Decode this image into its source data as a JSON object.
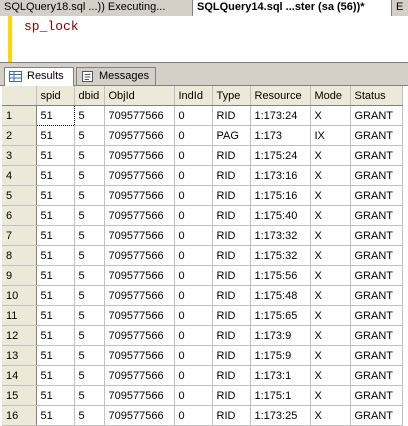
{
  "doc_tabs": [
    {
      "label": "SQLQuery18.sql ...)) Executing..."
    },
    {
      "label": "SQLQuery14.sql ...ster (sa (56))*"
    },
    {
      "label": "E"
    }
  ],
  "editor": {
    "code": "sp_lock"
  },
  "result_tabs": [
    {
      "label": "Results"
    },
    {
      "label": "Messages"
    }
  ],
  "table": {
    "headers": [
      "spid",
      "dbid",
      "ObjId",
      "IndId",
      "Type",
      "Resource",
      "Mode",
      "Status"
    ],
    "rows": [
      {
        "n": "1",
        "c": [
          "51",
          "5",
          "709577566",
          "0",
          "RID",
          "1:173:24",
          "X",
          "GRANT"
        ]
      },
      {
        "n": "2",
        "c": [
          "51",
          "5",
          "709577566",
          "0",
          "PAG",
          "1:173",
          "IX",
          "GRANT"
        ]
      },
      {
        "n": "3",
        "c": [
          "51",
          "5",
          "709577566",
          "0",
          "RID",
          "1:175:24",
          "X",
          "GRANT"
        ]
      },
      {
        "n": "4",
        "c": [
          "51",
          "5",
          "709577566",
          "0",
          "RID",
          "1:173:16",
          "X",
          "GRANT"
        ]
      },
      {
        "n": "5",
        "c": [
          "51",
          "5",
          "709577566",
          "0",
          "RID",
          "1:175:16",
          "X",
          "GRANT"
        ]
      },
      {
        "n": "6",
        "c": [
          "51",
          "5",
          "709577566",
          "0",
          "RID",
          "1:175:40",
          "X",
          "GRANT"
        ]
      },
      {
        "n": "7",
        "c": [
          "51",
          "5",
          "709577566",
          "0",
          "RID",
          "1:173:32",
          "X",
          "GRANT"
        ]
      },
      {
        "n": "8",
        "c": [
          "51",
          "5",
          "709577566",
          "0",
          "RID",
          "1:175:32",
          "X",
          "GRANT"
        ]
      },
      {
        "n": "9",
        "c": [
          "51",
          "5",
          "709577566",
          "0",
          "RID",
          "1:175:56",
          "X",
          "GRANT"
        ]
      },
      {
        "n": "10",
        "c": [
          "51",
          "5",
          "709577566",
          "0",
          "RID",
          "1:175:48",
          "X",
          "GRANT"
        ]
      },
      {
        "n": "11",
        "c": [
          "51",
          "5",
          "709577566",
          "0",
          "RID",
          "1:175:65",
          "X",
          "GRANT"
        ]
      },
      {
        "n": "12",
        "c": [
          "51",
          "5",
          "709577566",
          "0",
          "RID",
          "1:173:9",
          "X",
          "GRANT"
        ]
      },
      {
        "n": "13",
        "c": [
          "51",
          "5",
          "709577566",
          "0",
          "RID",
          "1:175:9",
          "X",
          "GRANT"
        ]
      },
      {
        "n": "14",
        "c": [
          "51",
          "5",
          "709577566",
          "0",
          "RID",
          "1:173:1",
          "X",
          "GRANT"
        ]
      },
      {
        "n": "15",
        "c": [
          "51",
          "5",
          "709577566",
          "0",
          "RID",
          "1:175:1",
          "X",
          "GRANT"
        ]
      },
      {
        "n": "16",
        "c": [
          "51",
          "5",
          "709577566",
          "0",
          "RID",
          "1:173:25",
          "X",
          "GRANT"
        ]
      }
    ]
  }
}
